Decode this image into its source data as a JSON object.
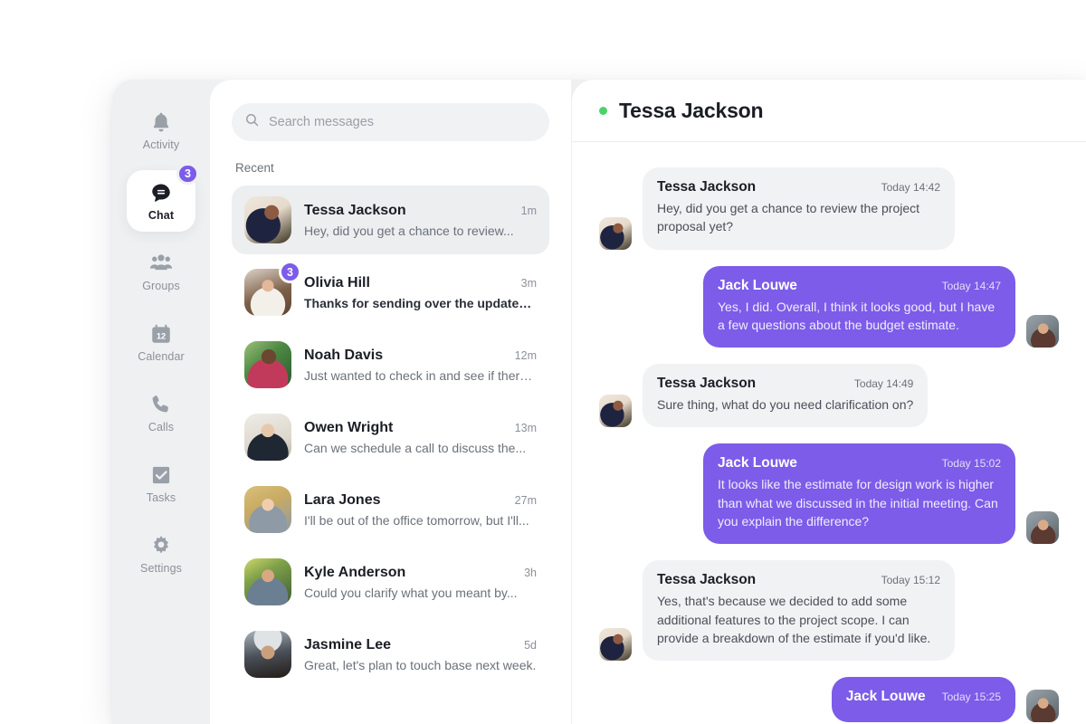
{
  "colors": {
    "accent_purple": "#7c5ce8",
    "online_green": "#4bd36a",
    "panel_gray": "#eff0f2",
    "bubble_gray": "#f1f2f4"
  },
  "nav": {
    "items": [
      {
        "label": "Activity",
        "icon": "bell-icon",
        "active": false,
        "badge": null
      },
      {
        "label": "Chat",
        "icon": "chat-bubble-icon",
        "active": true,
        "badge": "3"
      },
      {
        "label": "Groups",
        "icon": "people-group-icon",
        "active": false,
        "badge": null
      },
      {
        "label": "Calendar",
        "icon": "calendar-icon",
        "active": false,
        "badge": null
      },
      {
        "label": "Calls",
        "icon": "phone-icon",
        "active": false,
        "badge": null
      },
      {
        "label": "Tasks",
        "icon": "tasks-check-icon",
        "active": false,
        "badge": null
      },
      {
        "label": "Settings",
        "icon": "gear-icon",
        "active": false,
        "badge": null
      }
    ]
  },
  "search": {
    "placeholder": "Search messages",
    "value": "",
    "icon": "search-icon"
  },
  "list": {
    "section_label": "Recent",
    "conversations": [
      {
        "name": "Tessa Jackson",
        "time": "1m",
        "preview": "Hey, did you get a chance to review...",
        "badge": null,
        "selected": true,
        "unread": false,
        "avatar": "tessa"
      },
      {
        "name": "Olivia Hill",
        "time": "3m",
        "preview": "Thanks for sending over the updated...",
        "badge": "3",
        "selected": false,
        "unread": true,
        "avatar": "olivia"
      },
      {
        "name": "Noah Davis",
        "time": "12m",
        "preview": "Just wanted to check in and see if there...",
        "badge": null,
        "selected": false,
        "unread": false,
        "avatar": "noah"
      },
      {
        "name": "Owen Wright",
        "time": "13m",
        "preview": "Can we schedule a call to discuss the...",
        "badge": null,
        "selected": false,
        "unread": false,
        "avatar": "owen"
      },
      {
        "name": "Lara Jones",
        "time": "27m",
        "preview": "I'll be out of the office tomorrow, but I'll...",
        "badge": null,
        "selected": false,
        "unread": false,
        "avatar": "lara"
      },
      {
        "name": "Kyle Anderson",
        "time": "3h",
        "preview": "Could you clarify what you meant by...",
        "badge": null,
        "selected": false,
        "unread": false,
        "avatar": "kyle"
      },
      {
        "name": "Jasmine Lee",
        "time": "5d",
        "preview": "Great, let's plan to touch base next week.",
        "badge": null,
        "selected": false,
        "unread": false,
        "avatar": "jasmine"
      }
    ]
  },
  "chat": {
    "title": "Tessa Jackson",
    "status": "online",
    "messages": [
      {
        "sender": "Tessa Jackson",
        "time": "Today 14:42",
        "text": "Hey, did you get a chance to review the project proposal yet?",
        "direction": "in",
        "avatar": "tessa"
      },
      {
        "sender": "Jack Louwe",
        "time": "Today 14:47",
        "text": "Yes, I did. Overall, I think it looks good, but I have a few questions about the budget estimate.",
        "direction": "out",
        "avatar": "jack"
      },
      {
        "sender": "Tessa Jackson",
        "time": "Today 14:49",
        "text": "Sure thing, what do you need clarification on?",
        "direction": "in",
        "avatar": "tessa"
      },
      {
        "sender": "Jack Louwe",
        "time": "Today 15:02",
        "text": "It looks like the estimate for design work is higher than what we discussed in the initial meeting. Can you explain the difference?",
        "direction": "out",
        "avatar": "jack"
      },
      {
        "sender": "Tessa Jackson",
        "time": "Today 15:12",
        "text": "Yes, that's because we decided to add some additional features to the project scope. I can provide a breakdown of the estimate if you'd like.",
        "direction": "in",
        "avatar": "tessa"
      },
      {
        "sender": "Jack Louwe",
        "time": "Today 15:25",
        "text": "",
        "direction": "out",
        "avatar": "jack"
      }
    ]
  }
}
